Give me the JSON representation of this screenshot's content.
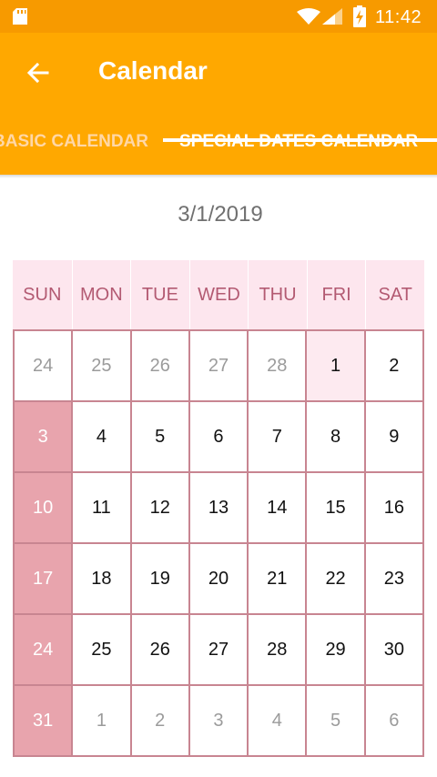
{
  "status_bar": {
    "time": "11:42",
    "icons": [
      "sd-card-icon",
      "wifi-icon",
      "signal-icon",
      "battery-charging-icon"
    ]
  },
  "app_bar": {
    "title": "Calendar",
    "back_icon": "arrow-back-icon"
  },
  "tabs": [
    {
      "label": "BASIC CALENDAR",
      "active": false
    },
    {
      "label": "SPECIAL DATES CALENDAR",
      "active": true
    }
  ],
  "selected_date": "3/1/2019",
  "calendar": {
    "weekdays": [
      "SUN",
      "MON",
      "TUE",
      "WED",
      "THU",
      "FRI",
      "SAT"
    ],
    "weeks": [
      [
        {
          "d": "24",
          "type": "other"
        },
        {
          "d": "25",
          "type": "other"
        },
        {
          "d": "26",
          "type": "other"
        },
        {
          "d": "27",
          "type": "other"
        },
        {
          "d": "28",
          "type": "other"
        },
        {
          "d": "1",
          "type": "today"
        },
        {
          "d": "2",
          "type": "normal"
        }
      ],
      [
        {
          "d": "3",
          "type": "sunday"
        },
        {
          "d": "4",
          "type": "normal"
        },
        {
          "d": "5",
          "type": "normal"
        },
        {
          "d": "6",
          "type": "normal"
        },
        {
          "d": "7",
          "type": "normal"
        },
        {
          "d": "8",
          "type": "normal"
        },
        {
          "d": "9",
          "type": "normal"
        }
      ],
      [
        {
          "d": "10",
          "type": "sunday"
        },
        {
          "d": "11",
          "type": "normal"
        },
        {
          "d": "12",
          "type": "normal"
        },
        {
          "d": "13",
          "type": "normal"
        },
        {
          "d": "14",
          "type": "normal"
        },
        {
          "d": "15",
          "type": "normal"
        },
        {
          "d": "16",
          "type": "normal"
        }
      ],
      [
        {
          "d": "17",
          "type": "sunday"
        },
        {
          "d": "18",
          "type": "normal"
        },
        {
          "d": "19",
          "type": "normal"
        },
        {
          "d": "20",
          "type": "normal"
        },
        {
          "d": "21",
          "type": "normal"
        },
        {
          "d": "22",
          "type": "normal"
        },
        {
          "d": "23",
          "type": "normal"
        }
      ],
      [
        {
          "d": "24",
          "type": "sunday"
        },
        {
          "d": "25",
          "type": "normal"
        },
        {
          "d": "26",
          "type": "normal"
        },
        {
          "d": "27",
          "type": "normal"
        },
        {
          "d": "28",
          "type": "normal"
        },
        {
          "d": "29",
          "type": "normal"
        },
        {
          "d": "30",
          "type": "normal"
        }
      ],
      [
        {
          "d": "31",
          "type": "sunday"
        },
        {
          "d": "1",
          "type": "other"
        },
        {
          "d": "2",
          "type": "other"
        },
        {
          "d": "3",
          "type": "other"
        },
        {
          "d": "4",
          "type": "other"
        },
        {
          "d": "5",
          "type": "other"
        },
        {
          "d": "6",
          "type": "other"
        }
      ]
    ]
  },
  "colors": {
    "status_bar": "#f79a00",
    "app_bar": "#ffa800",
    "header_bg": "#fde6ee",
    "header_text": "#b35a72",
    "grid_border": "#c88591",
    "special_date_bg": "#e8a4ad",
    "today_bg": "#fdeaf0"
  }
}
